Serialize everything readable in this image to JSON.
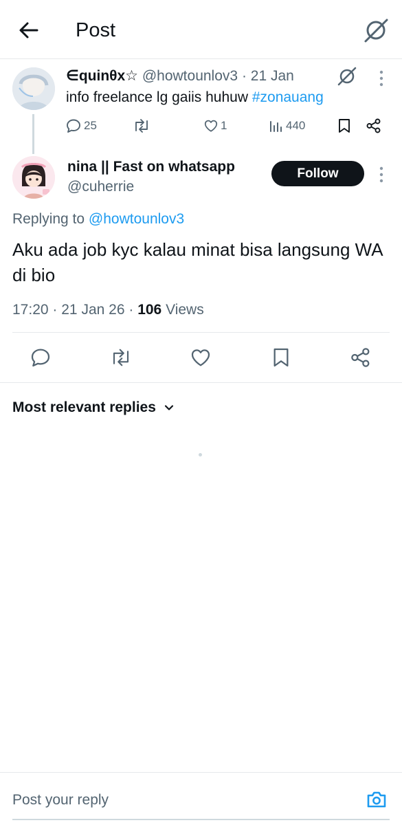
{
  "header": {
    "title": "Post",
    "back_icon": "arrow-left-icon",
    "grok_icon": "grok-icon"
  },
  "parent_tweet": {
    "display_name": "∈quinθx☆",
    "handle": "@howtounlov3",
    "separator": "·",
    "date": "21 Jan",
    "text": "info freelance lg gaiis huhuw ",
    "hashtag": "#zonauang",
    "replies": "25",
    "retweets": "",
    "likes": "1",
    "views": "440"
  },
  "main_tweet": {
    "display_name": "nina || Fast on whatsapp",
    "handle": "@cuherrie",
    "follow_label": "Follow",
    "replying_prefix": "Replying to ",
    "replying_to": "@howtounlov3",
    "text": "Aku ada job kyc kalau minat bisa langsung WA di bio",
    "time": "17:20",
    "date": "21 Jan 26",
    "views_count": "106",
    "views_label": "Views"
  },
  "replies_section": {
    "sort_label": "Most relevant replies"
  },
  "reply_bar": {
    "placeholder": "Post your reply"
  },
  "colors": {
    "accent": "#1d9bf0",
    "text_primary": "#0f1419",
    "text_secondary": "#536471",
    "divider": "#e6e9eb",
    "button_dark": "#0f1419"
  }
}
